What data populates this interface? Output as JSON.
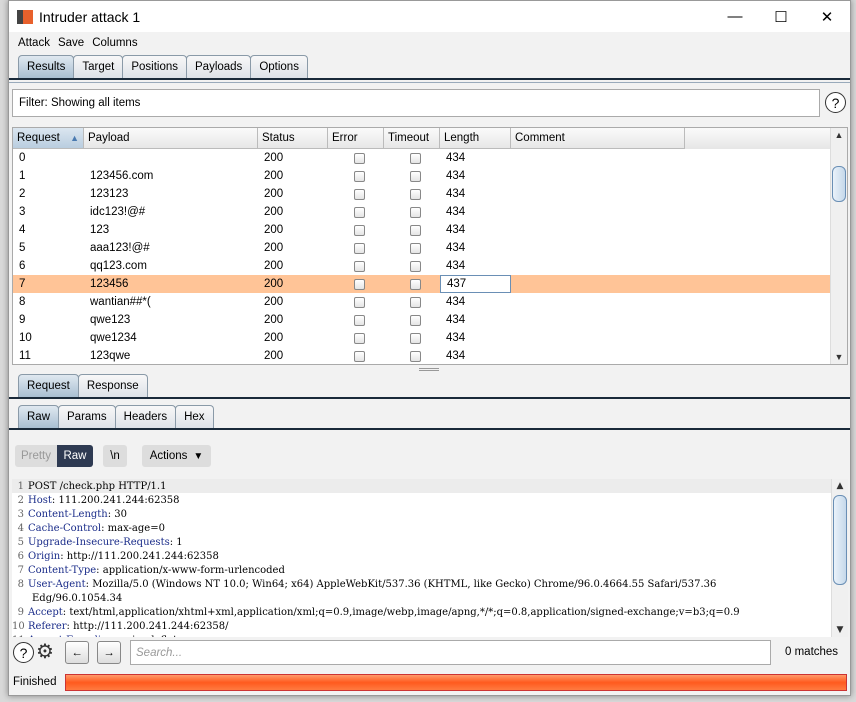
{
  "window": {
    "title": "Intruder attack 1",
    "minimize": "—",
    "maximize": "☐",
    "close": "✕"
  },
  "menu": [
    "Attack",
    "Save",
    "Columns"
  ],
  "tabs": [
    "Results",
    "Target",
    "Positions",
    "Payloads",
    "Options"
  ],
  "active_tab": "Results",
  "filter": "Filter: Showing all items",
  "help": "?",
  "table": {
    "columns": [
      "Request",
      "Payload",
      "Status",
      "Error",
      "Timeout",
      "Length",
      "Comment"
    ],
    "sort_indicator": "▲",
    "rows": [
      {
        "request": "0",
        "payload": "",
        "status": "200",
        "error": false,
        "timeout": false,
        "length": "434",
        "comment": ""
      },
      {
        "request": "1",
        "payload": "123456.com",
        "status": "200",
        "error": false,
        "timeout": false,
        "length": "434",
        "comment": ""
      },
      {
        "request": "2",
        "payload": "123123",
        "status": "200",
        "error": false,
        "timeout": false,
        "length": "434",
        "comment": ""
      },
      {
        "request": "3",
        "payload": "idc123!@#",
        "status": "200",
        "error": false,
        "timeout": false,
        "length": "434",
        "comment": ""
      },
      {
        "request": "4",
        "payload": "123",
        "status": "200",
        "error": false,
        "timeout": false,
        "length": "434",
        "comment": ""
      },
      {
        "request": "5",
        "payload": "aaa123!@#",
        "status": "200",
        "error": false,
        "timeout": false,
        "length": "434",
        "comment": ""
      },
      {
        "request": "6",
        "payload": "qq123.com",
        "status": "200",
        "error": false,
        "timeout": false,
        "length": "434",
        "comment": ""
      },
      {
        "request": "7",
        "payload": "123456",
        "status": "200",
        "error": false,
        "timeout": false,
        "length": "437",
        "comment": "",
        "selected": true
      },
      {
        "request": "8",
        "payload": "wantian##*(",
        "status": "200",
        "error": false,
        "timeout": false,
        "length": "434",
        "comment": ""
      },
      {
        "request": "9",
        "payload": "qwe123",
        "status": "200",
        "error": false,
        "timeout": false,
        "length": "434",
        "comment": ""
      },
      {
        "request": "10",
        "payload": "qwe1234",
        "status": "200",
        "error": false,
        "timeout": false,
        "length": "434",
        "comment": ""
      },
      {
        "request": "11",
        "payload": "123qwe",
        "status": "200",
        "error": false,
        "timeout": false,
        "length": "434",
        "comment": ""
      }
    ]
  },
  "reqres_tabs": [
    "Request",
    "Response"
  ],
  "view_tabs": [
    "Raw",
    "Params",
    "Headers",
    "Hex"
  ],
  "toolbar": {
    "pretty": "Pretty",
    "raw": "Raw",
    "newline": "\\n",
    "actions": "Actions"
  },
  "request_lines": [
    {
      "n": "1",
      "key": "",
      "val": "POST /check.php HTTP/1.1"
    },
    {
      "n": "2",
      "key": "Host",
      "val": " 111.200.241.244:62358"
    },
    {
      "n": "3",
      "key": "Content-Length",
      "val": " 30"
    },
    {
      "n": "4",
      "key": "Cache-Control",
      "val": " max-age=0"
    },
    {
      "n": "5",
      "key": "Upgrade-Insecure-Requests",
      "val": " 1"
    },
    {
      "n": "6",
      "key": "Origin",
      "val": " http://111.200.241.244:62358"
    },
    {
      "n": "7",
      "key": "Content-Type",
      "val": " application/x-www-form-urlencoded"
    },
    {
      "n": "8",
      "key": "User-Agent",
      "val": " Mozilla/5.0 (Windows NT 10.0; Win64; x64) AppleWebKit/537.36 (KHTML, like Gecko) Chrome/96.0.4664.55 Safari/537.36",
      "cont": "Edg/96.0.1054.34"
    },
    {
      "n": "9",
      "key": "Accept",
      "val": " text/html,application/xhtml+xml,application/xml;q=0.9,image/webp,image/apng,*/*;q=0.8,application/signed-exchange;v=b3;q=0.9"
    },
    {
      "n": "10",
      "key": "Referer",
      "val": " http://111.200.241.244:62358/"
    },
    {
      "n": "11",
      "key": "Accept-Encoding",
      "val": " gzip, deflate"
    }
  ],
  "search": {
    "placeholder": "Search...",
    "matches": "0 matches"
  },
  "status": {
    "text": "Finished",
    "progress_percent": 100,
    "color": "#ff6a2e"
  }
}
